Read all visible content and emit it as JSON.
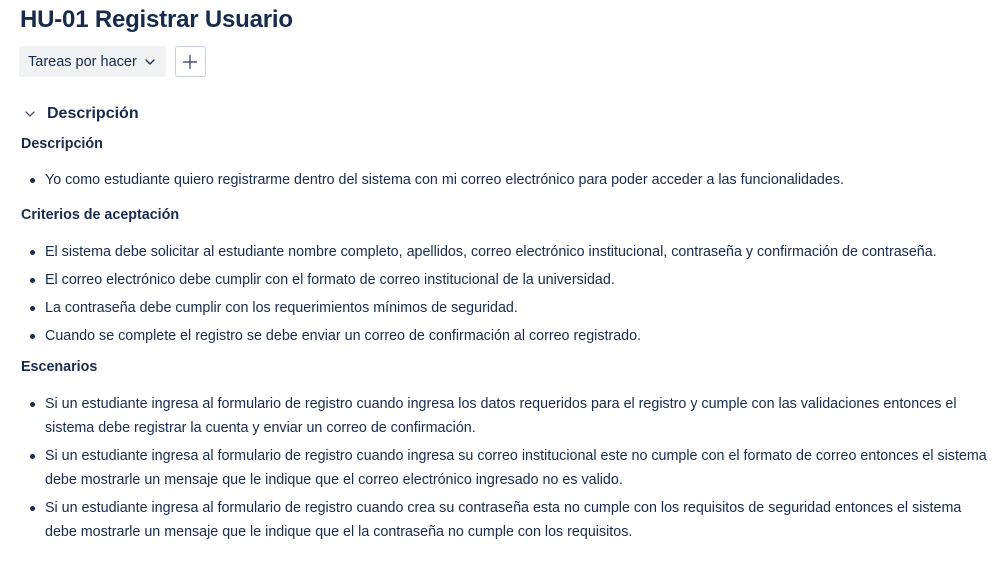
{
  "header": {
    "title": "HU-01 Registrar Usuario"
  },
  "toolbar": {
    "status_label": "Tareas por hacer",
    "status_icon": "chevron-down-icon",
    "add_icon": "plus-icon"
  },
  "section": {
    "title": "Descripción",
    "toggle_icon": "chevron-down-icon"
  },
  "description": {
    "heading": "Descripción",
    "items": [
      "Yo como estudiante quiero registrarme dentro del sistema con mi correo electrónico para poder  acceder a las funcionalidades."
    ]
  },
  "criteria": {
    "heading": "Criterios de aceptación",
    "items": [
      "El sistema debe solicitar al estudiante nombre completo, apellidos, correo electrónico institucional, contraseña y confirmación de contraseña.",
      "El correo electrónico debe cumplir con el formato de correo institucional de la universidad.",
      "La contraseña debe cumplir con los requerimientos mínimos de seguridad.",
      "Cuando se complete el registro se debe enviar un correo de confirmación al correo registrado."
    ]
  },
  "scenarios": {
    "heading": "Escenarios",
    "items": [
      "Si un estudiante ingresa al formulario de registro cuando ingresa los datos requeridos para el registro y cumple con las validaciones entonces el sistema debe registrar la cuenta y enviar un correo de confirmación.",
      "Si un estudiante ingresa al formulario de registro cuando ingresa su correo institucional este no cumple con el formato de correo entonces el sistema debe mostrarle un mensaje que le indique que el correo electrónico ingresado no es valido.",
      "Si un estudiante ingresa al formulario de registro cuando crea su contraseña esta no cumple con los requisitos de seguridad entonces el sistema debe mostrarle un mensaje que le indique que el la contraseña no cumple con los requisitos."
    ]
  }
}
